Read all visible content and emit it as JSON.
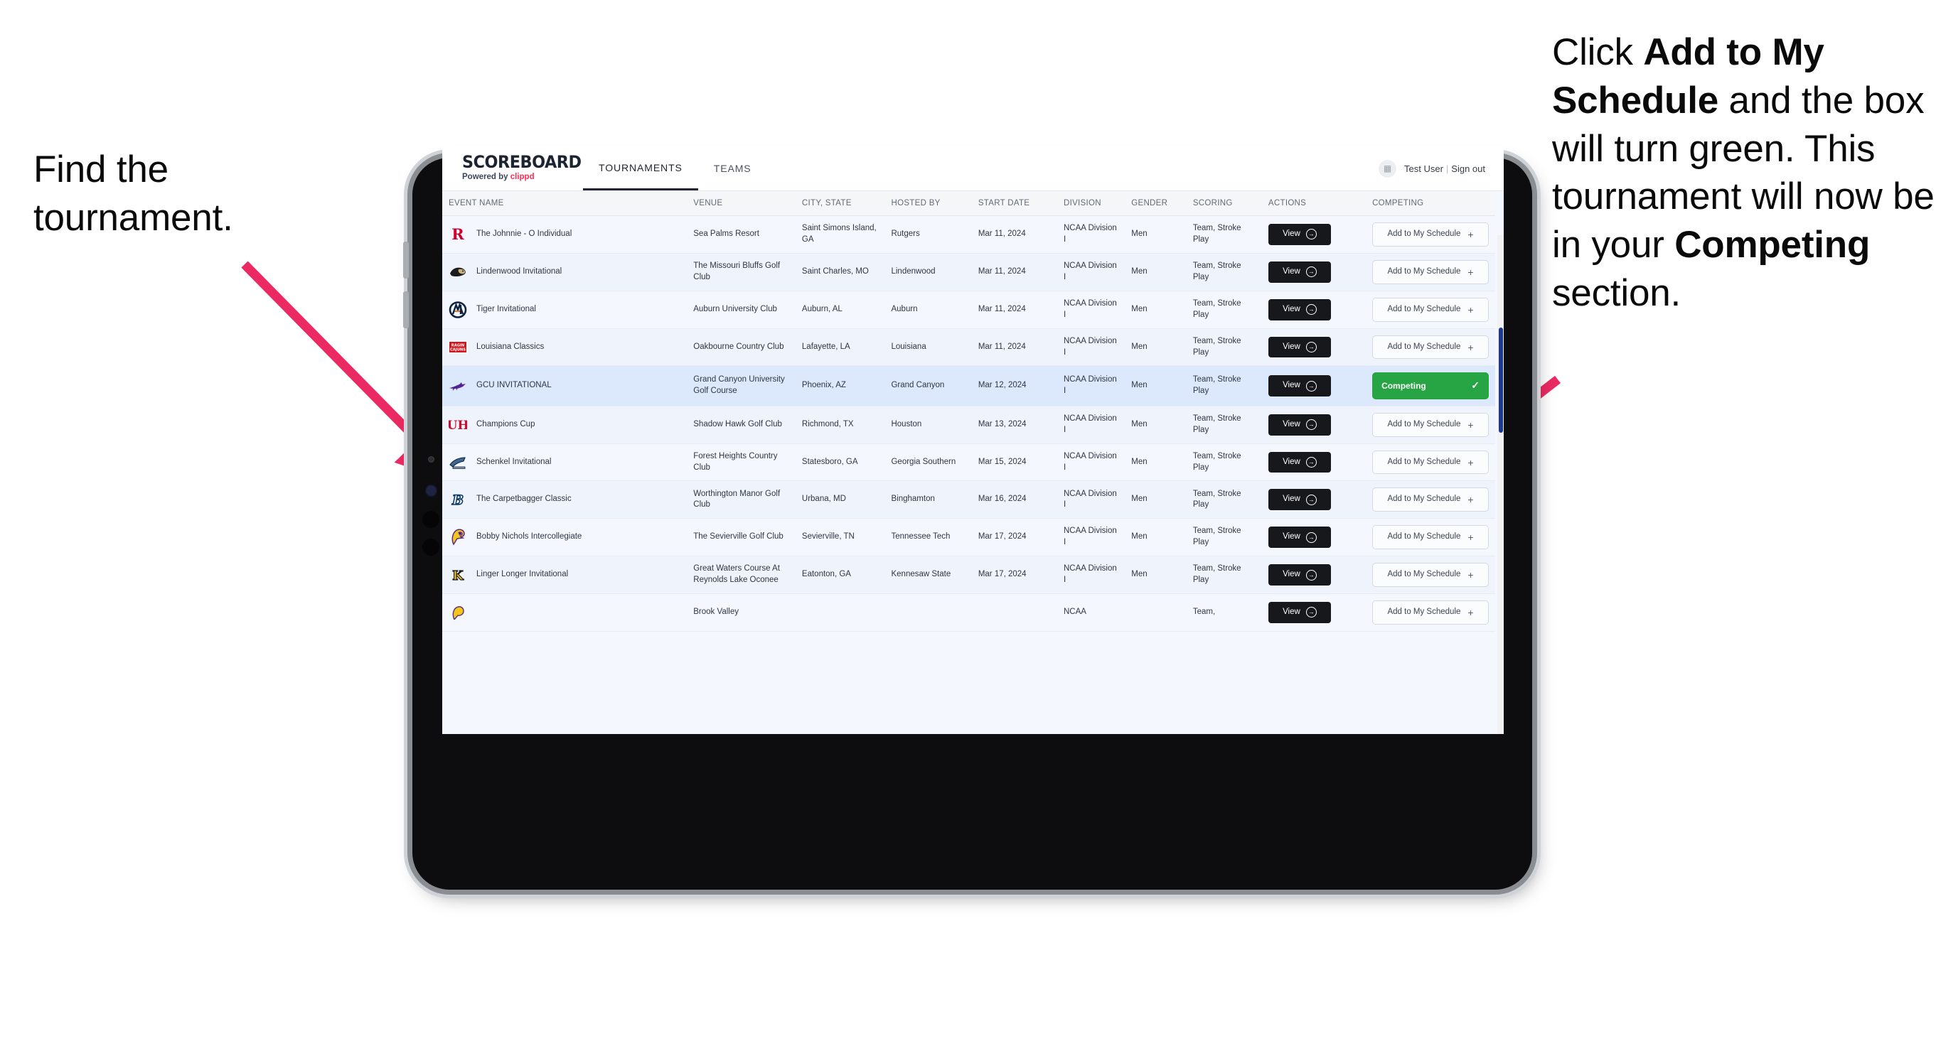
{
  "annotations": {
    "left": {
      "line1": "Find the",
      "line2": "tournament."
    },
    "right": {
      "p1_pre": "Click ",
      "p1_bold": "Add to My Schedule",
      "p1_post": " and the box will turn green. This tournament will now be in your ",
      "p2_bold": "Competing",
      "p2_post": " section."
    },
    "arrow_color": "#eb2a63"
  },
  "app": {
    "brand": {
      "title": "SCOREBOARD",
      "sub_prefix": "Powered by ",
      "sub_brand": "clippd",
      "brand_color": "#ff2d55"
    },
    "tabs": [
      {
        "label": "TOURNAMENTS",
        "active": true
      },
      {
        "label": "TEAMS",
        "active": false
      }
    ],
    "user": {
      "avatar_icon": "user-avatar-icon",
      "name": "Test User",
      "separator": "|",
      "signout": "Sign out"
    }
  },
  "table": {
    "columns": [
      "EVENT NAME",
      "VENUE",
      "CITY, STATE",
      "HOSTED BY",
      "START DATE",
      "DIVISION",
      "GENDER",
      "SCORING",
      "ACTIONS",
      "COMPETING"
    ],
    "buttons": {
      "view": "View",
      "view_icon": "arrow-right-circle-icon",
      "add": "Add to My Schedule",
      "add_icon": "plus-icon",
      "competing": "Competing",
      "competing_icon": "check-icon",
      "competing_color": "#27a544"
    },
    "rows": [
      {
        "logo": "rutgers-logo",
        "name": "The Johnnie - O Individual",
        "venue": "Sea Palms Resort",
        "city": "Saint Simons Island, GA",
        "host": "Rutgers",
        "date": "Mar 11, 2024",
        "division": "NCAA Division I",
        "gender": "Men",
        "scoring": "Team, Stroke Play",
        "competing": false,
        "selected": false
      },
      {
        "logo": "lindenwood-logo",
        "name": "Lindenwood Invitational",
        "venue": "The Missouri Bluffs Golf Club",
        "city": "Saint Charles, MO",
        "host": "Lindenwood",
        "date": "Mar 11, 2024",
        "division": "NCAA Division I",
        "gender": "Men",
        "scoring": "Team, Stroke Play",
        "competing": false,
        "selected": false
      },
      {
        "logo": "auburn-logo",
        "name": "Tiger Invitational",
        "venue": "Auburn University Club",
        "city": "Auburn, AL",
        "host": "Auburn",
        "date": "Mar 11, 2024",
        "division": "NCAA Division I",
        "gender": "Men",
        "scoring": "Team, Stroke Play",
        "competing": false,
        "selected": false
      },
      {
        "logo": "louisiana-logo",
        "name": "Louisiana Classics",
        "venue": "Oakbourne Country Club",
        "city": "Lafayette, LA",
        "host": "Louisiana",
        "date": "Mar 11, 2024",
        "division": "NCAA Division I",
        "gender": "Men",
        "scoring": "Team, Stroke Play",
        "competing": false,
        "selected": false
      },
      {
        "logo": "gcu-logo",
        "name": "GCU INVITATIONAL",
        "venue": "Grand Canyon University Golf Course",
        "city": "Phoenix, AZ",
        "host": "Grand Canyon",
        "date": "Mar 12, 2024",
        "division": "NCAA Division I",
        "gender": "Men",
        "scoring": "Team, Stroke Play",
        "competing": true,
        "selected": true
      },
      {
        "logo": "houston-logo",
        "name": "Champions Cup",
        "venue": "Shadow Hawk Golf Club",
        "city": "Richmond, TX",
        "host": "Houston",
        "date": "Mar 13, 2024",
        "division": "NCAA Division I",
        "gender": "Men",
        "scoring": "Team, Stroke Play",
        "competing": false,
        "selected": false
      },
      {
        "logo": "georgia-southern-logo",
        "name": "Schenkel Invitational",
        "venue": "Forest Heights Country Club",
        "city": "Statesboro, GA",
        "host": "Georgia Southern",
        "date": "Mar 15, 2024",
        "division": "NCAA Division I",
        "gender": "Men",
        "scoring": "Team, Stroke Play",
        "competing": false,
        "selected": false
      },
      {
        "logo": "binghamton-logo",
        "name": "The Carpetbagger Classic",
        "venue": "Worthington Manor Golf Club",
        "city": "Urbana, MD",
        "host": "Binghamton",
        "date": "Mar 16, 2024",
        "division": "NCAA Division I",
        "gender": "Men",
        "scoring": "Team, Stroke Play",
        "competing": false,
        "selected": false
      },
      {
        "logo": "tennessee-tech-logo",
        "name": "Bobby Nichols Intercollegiate",
        "venue": "The Sevierville Golf Club",
        "city": "Sevierville, TN",
        "host": "Tennessee Tech",
        "date": "Mar 17, 2024",
        "division": "NCAA Division I",
        "gender": "Men",
        "scoring": "Team, Stroke Play",
        "competing": false,
        "selected": false
      },
      {
        "logo": "kennesaw-state-logo",
        "name": "Linger Longer Invitational",
        "venue": "Great Waters Course At Reynolds Lake Oconee",
        "city": "Eatonton, GA",
        "host": "Kennesaw State",
        "date": "Mar 17, 2024",
        "division": "NCAA Division I",
        "gender": "Men",
        "scoring": "Team, Stroke Play",
        "competing": false,
        "selected": false
      },
      {
        "logo": "ecu-logo",
        "name": "",
        "venue": "Brook Valley",
        "city": "",
        "host": "",
        "date": "",
        "division": "NCAA",
        "gender": "",
        "scoring": "Team,",
        "competing": false,
        "selected": false
      }
    ]
  }
}
